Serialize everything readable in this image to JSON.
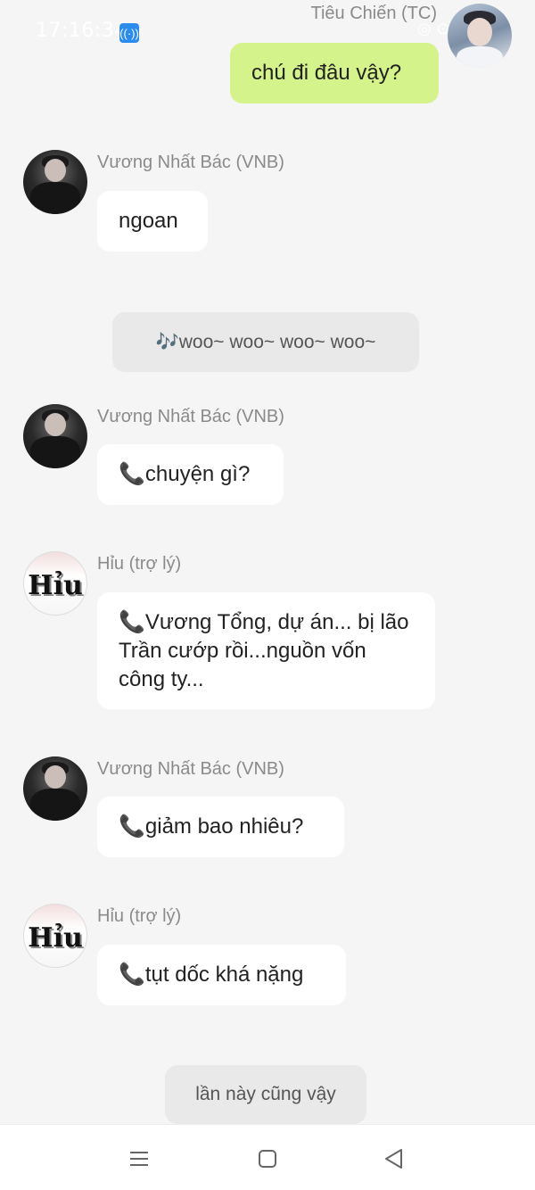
{
  "status_bar": {
    "time": "17:16:34",
    "hotspot_icon": "hotspot-icon",
    "right_icons": "◎ ⊙ ▮"
  },
  "messages": [
    {
      "side": "right",
      "sender": "Tiêu Chiến (TC)",
      "text": "chú đi đâu vậy?"
    },
    {
      "side": "left",
      "sender": "Vương Nhất Bác (VNB)",
      "text": "ngoan"
    },
    {
      "type": "system",
      "text": "🎶woo~ woo~ woo~ woo~"
    },
    {
      "side": "left",
      "sender": "Vương Nhất Bác (VNB)",
      "text": "📞chuyện gì?"
    },
    {
      "side": "left",
      "sender": "Hỉu (trợ lý)",
      "text": "📞Vương Tổng, dự án... bị lão Trần cướp rồi...nguồn vốn công ty..."
    },
    {
      "side": "left",
      "sender": "Vương Nhất Bác (VNB)",
      "text": "📞giảm bao nhiêu?"
    },
    {
      "side": "left",
      "sender": "Hỉu (trợ lý)",
      "text": "📞tụt dốc khá nặng"
    },
    {
      "type": "system",
      "text": "lần này cũng vậy"
    }
  ],
  "avatars": {
    "hiu_label": "Hỉu"
  },
  "colors": {
    "sent_bubble": "#d4f38a",
    "received_bubble": "#ffffff",
    "background": "#f5f5f5"
  },
  "nav": {
    "menu_icon": "menu-icon",
    "home_icon": "home-square-icon",
    "back_icon": "back-triangle-icon"
  }
}
